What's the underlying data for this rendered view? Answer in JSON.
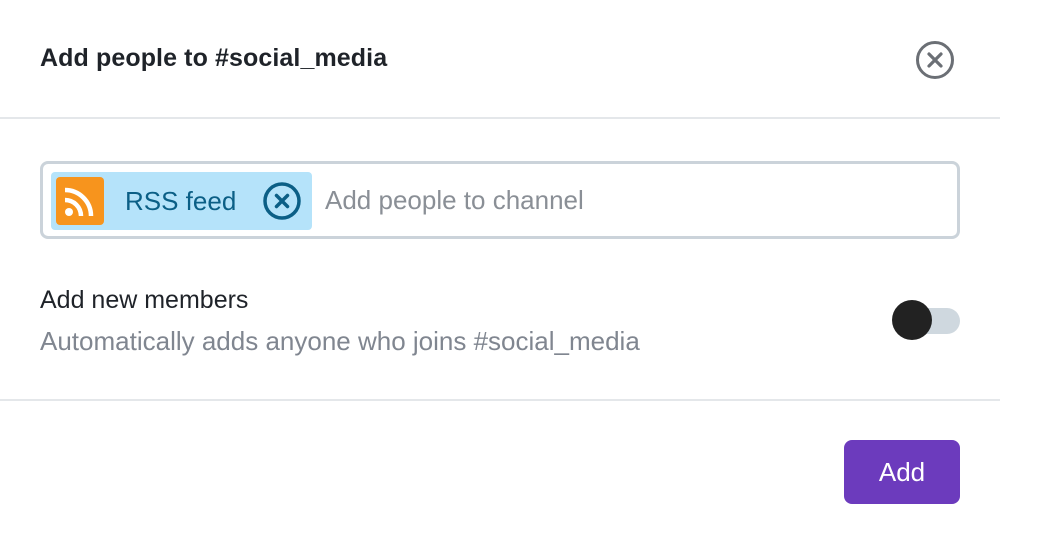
{
  "dialog": {
    "title": "Add people to #social_media",
    "close_icon": "close-circle-icon"
  },
  "chip_input": {
    "chips": [
      {
        "label": "RSS feed",
        "avatar_icon": "rss-icon",
        "avatar_color": "#f7941d",
        "remove_icon": "remove-circle-icon"
      }
    ],
    "value": "",
    "placeholder": "Add people to channel"
  },
  "auto_add": {
    "title": "Add new members",
    "description": "Automatically adds anyone who joins #social_media",
    "enabled": false
  },
  "footer": {
    "add_label": "Add"
  },
  "colors": {
    "accent": "#6c3bbd",
    "chip_background": "#b5e3fa",
    "chip_text": "#0b5f86",
    "rss_orange": "#f7941d"
  }
}
